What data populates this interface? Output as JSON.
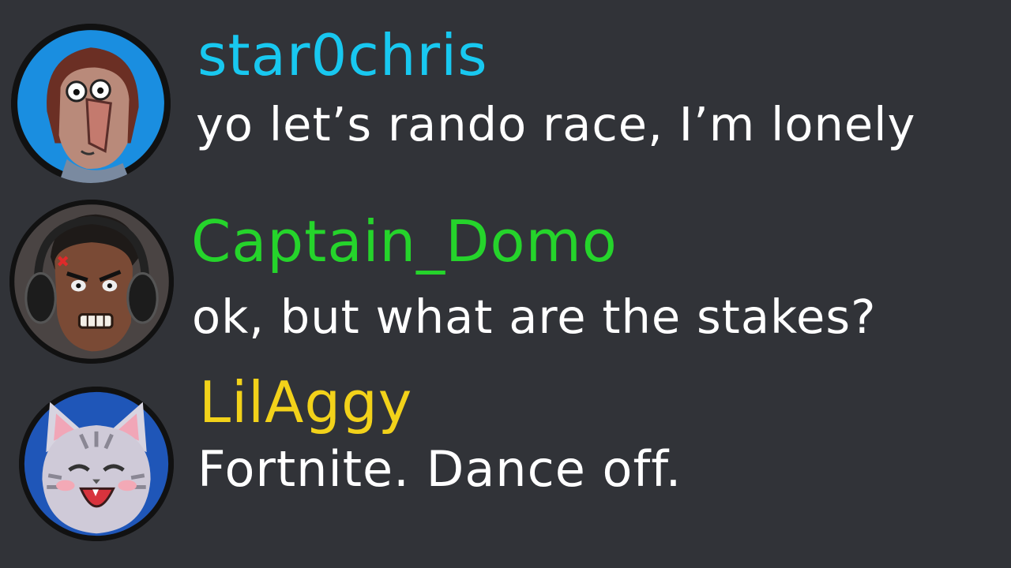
{
  "messages": [
    {
      "username": "star0chris",
      "username_color": "#18c8f0",
      "text": "yo let’s rando race, I’m lonely",
      "avatar": "cartoon-man-big-nose-avatar"
    },
    {
      "username": "Captain_Domo",
      "username_color": "#25d42b",
      "text": "ok, but what are the stakes?",
      "avatar": "angry-man-headphones-avatar"
    },
    {
      "username": "LilAggy",
      "username_color": "#f2d21a",
      "text": "Fortnite. Dance off.",
      "avatar": "gray-cat-laughing-avatar"
    }
  ],
  "background_color": "#313338",
  "message_text_color": "#ffffff"
}
